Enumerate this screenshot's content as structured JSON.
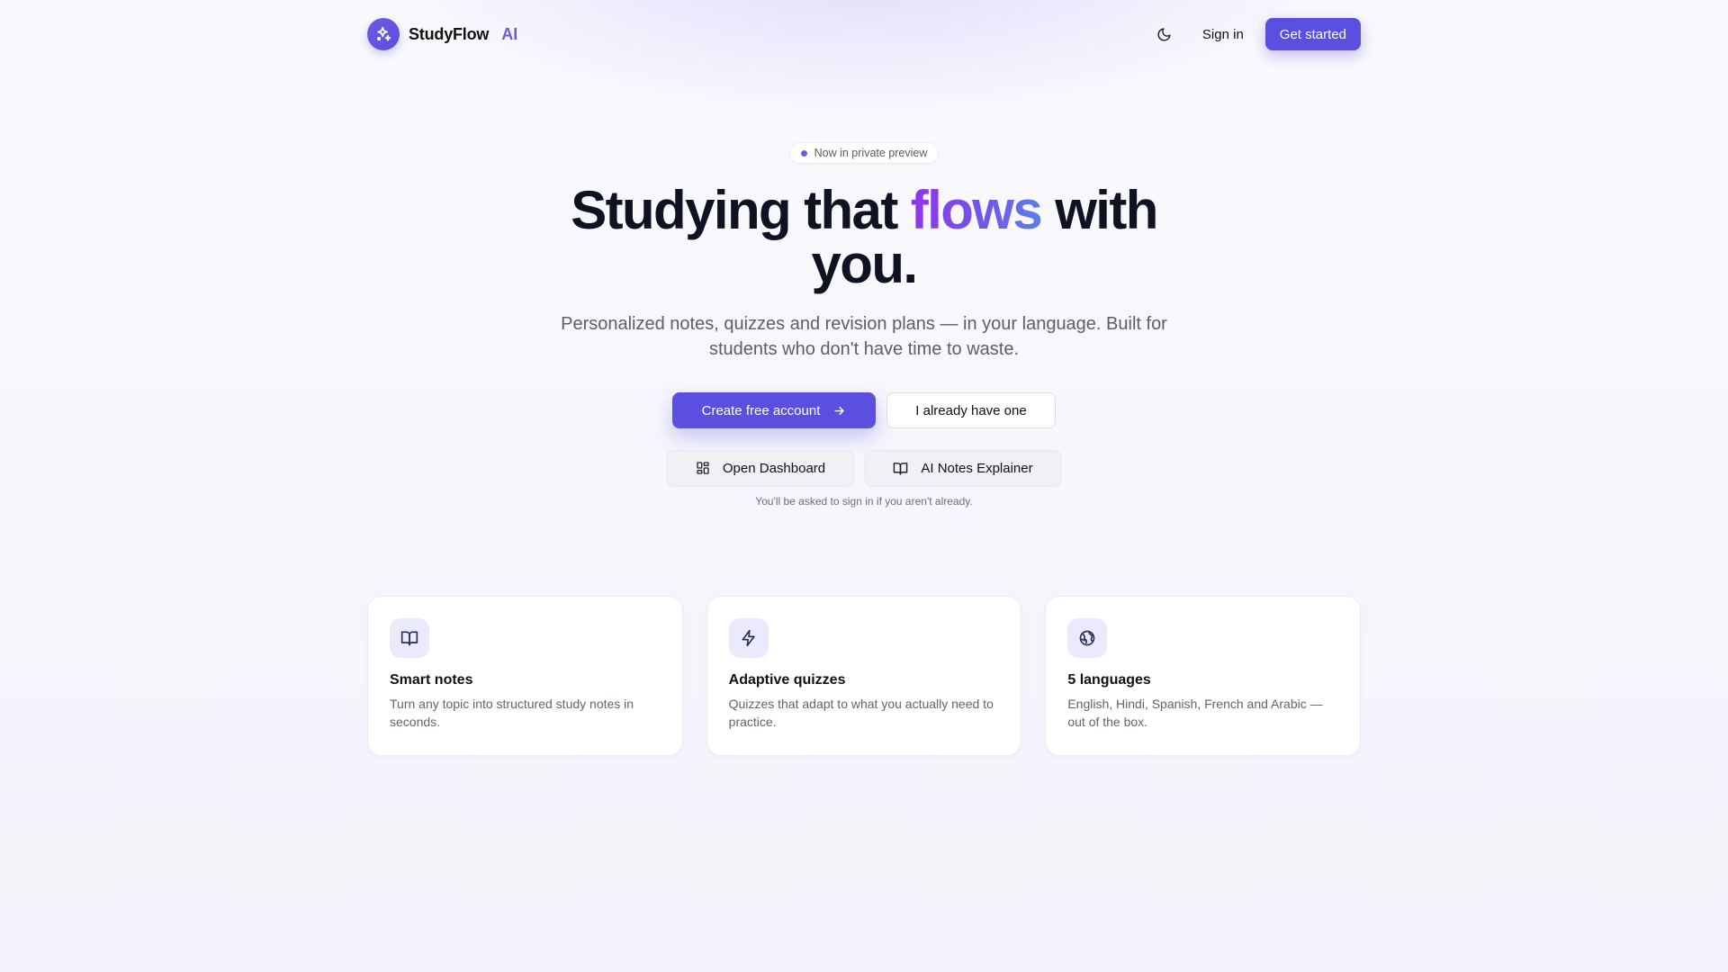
{
  "header": {
    "brand_name": "StudyFlow",
    "brand_suffix": "AI",
    "theme_toggle_icon": "moon-icon",
    "sign_in": "Sign in",
    "get_started": "Get started"
  },
  "hero": {
    "badge": "Now in private preview",
    "headline_before": "Studying that",
    "headline_accent": "flows",
    "headline_after": "with you.",
    "subheadline": "Personalized notes, quizzes and revision plans — in your language. Built for students who don't have time to waste.",
    "primary_cta": "Create free account",
    "secondary_cta": "I already have one",
    "dashboard_button": "Open Dashboard",
    "notes_button": "AI Notes Explainer",
    "hint": "You'll be asked to sign in if you aren't already."
  },
  "features": [
    {
      "icon": "book-open-icon",
      "title": "Smart notes",
      "text": "Turn any topic into structured study notes in seconds."
    },
    {
      "icon": "lightning-icon",
      "title": "Adaptive quizzes",
      "text": "Quizzes that adapt to what you actually need to practice."
    },
    {
      "icon": "globe-icon",
      "title": "5 languages",
      "text": "English, Hindi, Spanish, French and Arabic — out of the box."
    }
  ],
  "colors": {
    "accent": "#5b4fe0",
    "accent_gradient_start": "#9333ea",
    "accent_gradient_end": "#5b7fe8",
    "background": "#f7f8fc"
  }
}
